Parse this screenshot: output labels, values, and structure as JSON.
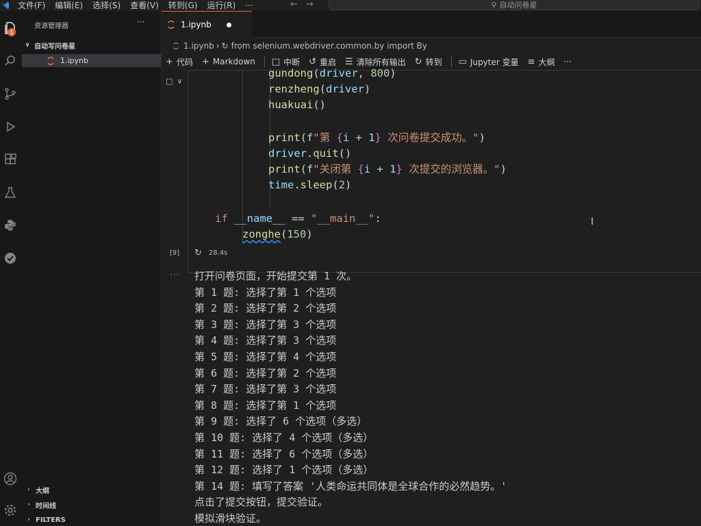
{
  "menu": [
    "文件(F)",
    "编辑(E)",
    "选择(S)",
    "查看(V)",
    "转到(G)",
    "运行(R)",
    "···"
  ],
  "search": {
    "text": "自动问卷星"
  },
  "activity": {
    "badge": "1"
  },
  "sidebar": {
    "title": "资源管理器",
    "more": "···",
    "folder": "自动写问卷星",
    "file": "1.ipynb",
    "sections": [
      "大纲",
      "时间线",
      "FILTERS"
    ]
  },
  "tab": {
    "label": "1.ipynb"
  },
  "breadcrumb": {
    "file": "1.ipynb",
    "symbol": "from selenium.webdriver.common.by import By"
  },
  "toolbar": {
    "code": "代码",
    "markdown": "Markdown",
    "interrupt": "中断",
    "restart": "重启",
    "clear": "清除所有输出",
    "goto": "转到",
    "vars": "Jupyter 变量",
    "outline": "大纲",
    "more": "···"
  },
  "code": {
    "l1_fn": "gundong",
    "l1_arg": "driver",
    "l1_num": "800",
    "l2_fn": "renzheng",
    "l2_arg": "driver",
    "l3_fn": "huakuai",
    "l4_fn": "print",
    "l4_str1": "\"第 ",
    "l4_expr": "i + 1",
    "l4_str2": " 次问卷提交成功。\"",
    "l5_obj": "driver",
    "l5_fn": "quit",
    "l6_fn": "print",
    "l6_str1": "\"关闭第 ",
    "l6_expr": "i + 1",
    "l6_str2": " 次提交的浏览器。\"",
    "l7_obj": "time",
    "l7_fn": "sleep",
    "l7_num": "2",
    "l8_kw": "if",
    "l8_var": "__name__",
    "l8_op": "==",
    "l8_str": "\"__main__\"",
    "l9_fn": "zonghe",
    "l9_num": "150"
  },
  "cell": {
    "count": "[9]",
    "time": "28.4s"
  },
  "output": [
    "打开问卷页面，开始提交第 1 次。",
    "第 1 题: 选择了第 1 个选项",
    "第 2 题: 选择了第 2 个选项",
    "第 3 题: 选择了第 3 个选项",
    "第 4 题: 选择了第 3 个选项",
    "第 5 题: 选择了第 4 个选项",
    "第 6 题: 选择了第 2 个选项",
    "第 7 题: 选择了第 3 个选项",
    "第 8 题: 选择了第 1 个选项",
    "第 9 题: 选择了 6 个选项（多选）",
    "第 10 题: 选择了 4 个选项（多选）",
    "第 11 题: 选择了 6 个选项（多选）",
    "第 12 题: 选择了 1 个选项（多选）",
    "第 14 题: 填写了答案 '人类命运共同体是全球合作的必然趋势。'",
    "点击了提交按钮，提交验证。",
    "模拟滑块验证。"
  ],
  "colors": {
    "accent": "#e06c3a",
    "fn": "#dcdcaa",
    "string": "#ce9178",
    "keyword": "#c586c0"
  }
}
